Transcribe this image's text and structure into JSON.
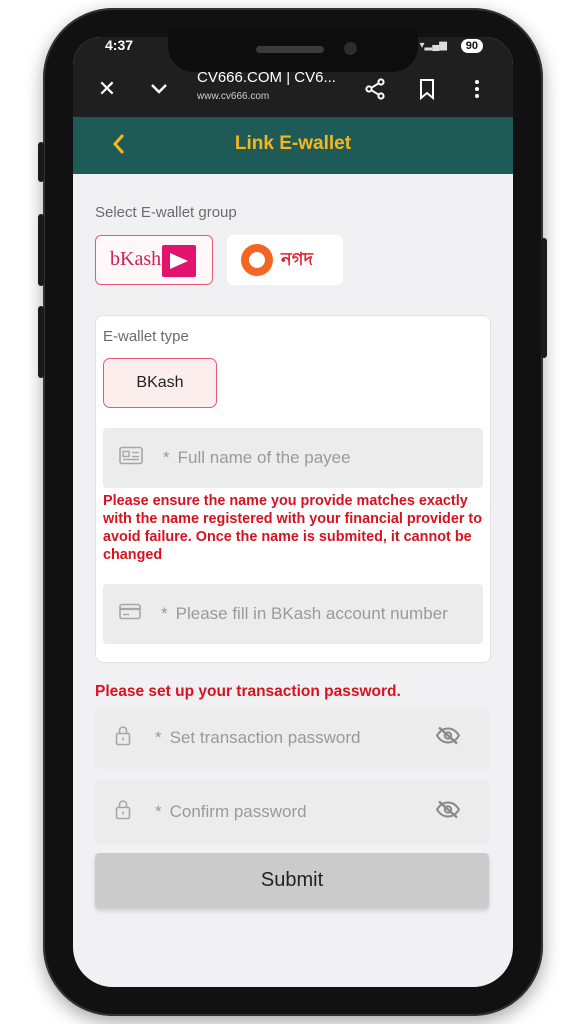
{
  "status_bar": {
    "time": "4:37",
    "battery": "90"
  },
  "browser": {
    "page_title": "CV666.COM | CV6...",
    "url": "www.cv666.com"
  },
  "app_bar": {
    "back_icon": "chevron-left-icon",
    "title": "Link E-wallet"
  },
  "wallet_group": {
    "label": "Select E-wallet group",
    "options": [
      {
        "name": "bKash",
        "selected": true
      },
      {
        "name": "নগদ",
        "selected": false
      }
    ]
  },
  "wallet_type": {
    "label": "E-wallet type",
    "selected": "BKash"
  },
  "payee_name": {
    "placeholder": "Full name of the payee",
    "required_mark": "*"
  },
  "name_warning": "Please ensure the name you provide matches exactly with the name registered with your financial provider to avoid failure. Once the name is submited, it cannot be changed",
  "account_number": {
    "placeholder": "Please fill in BKash account number",
    "required_mark": "*"
  },
  "password_notice": "Please set up your transaction password.",
  "transaction_password": {
    "placeholder": "Set transaction password",
    "required_mark": "*"
  },
  "confirm_password": {
    "placeholder": "Confirm password",
    "required_mark": "*"
  },
  "submit_label": "Submit",
  "colors": {
    "header_bg": "#1e5b57",
    "accent": "#f5b71e",
    "warning": "#d8121f",
    "selected_border": "#e25a76"
  }
}
